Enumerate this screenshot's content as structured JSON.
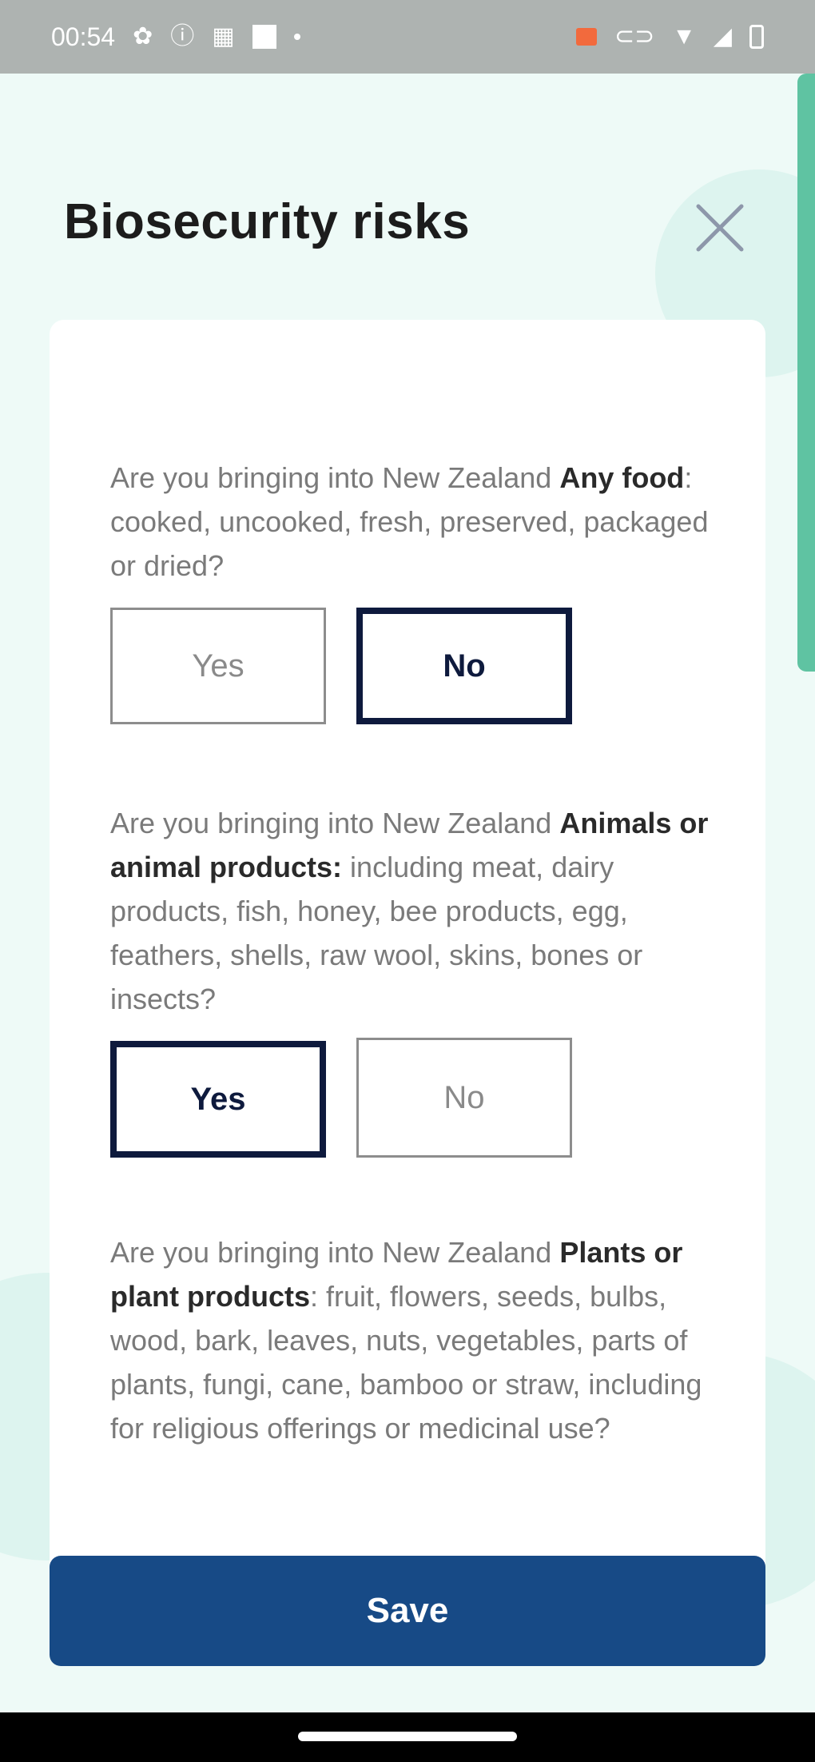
{
  "status_bar": {
    "time": "00:54"
  },
  "header": {
    "title": "Biosecurity risks"
  },
  "questions": [
    {
      "prefix": "Are you bringing into New Zealand ",
      "bold": "Any food",
      "suffix": ": cooked, uncooked, fresh, preserved, packaged or dried?",
      "yes_label": "Yes",
      "no_label": "No",
      "selected": "No"
    },
    {
      "prefix": "Are you bringing into New Zealand ",
      "bold": "Animals or animal products:",
      "suffix": " including meat, dairy products, fish, honey, bee products, egg, feathers, shells, raw wool, skins, bones or insects?",
      "yes_label": "Yes",
      "no_label": "No",
      "selected": "Yes"
    },
    {
      "prefix": "Are you bringing into New Zealand ",
      "bold": "Plants or plant products",
      "suffix": ": fruit, flowers, seeds, bulbs, wood, bark, leaves, nuts, vegetables, parts of plants, fungi, cane, bamboo or straw, including for religious offerings or medicinal use?"
    }
  ],
  "footer": {
    "save_label": "Save"
  },
  "colors": {
    "background": "#eefaf7",
    "accent": "#174a86",
    "selected_border": "#0e1a3d",
    "scroll_indicator": "#5fc3a2"
  }
}
